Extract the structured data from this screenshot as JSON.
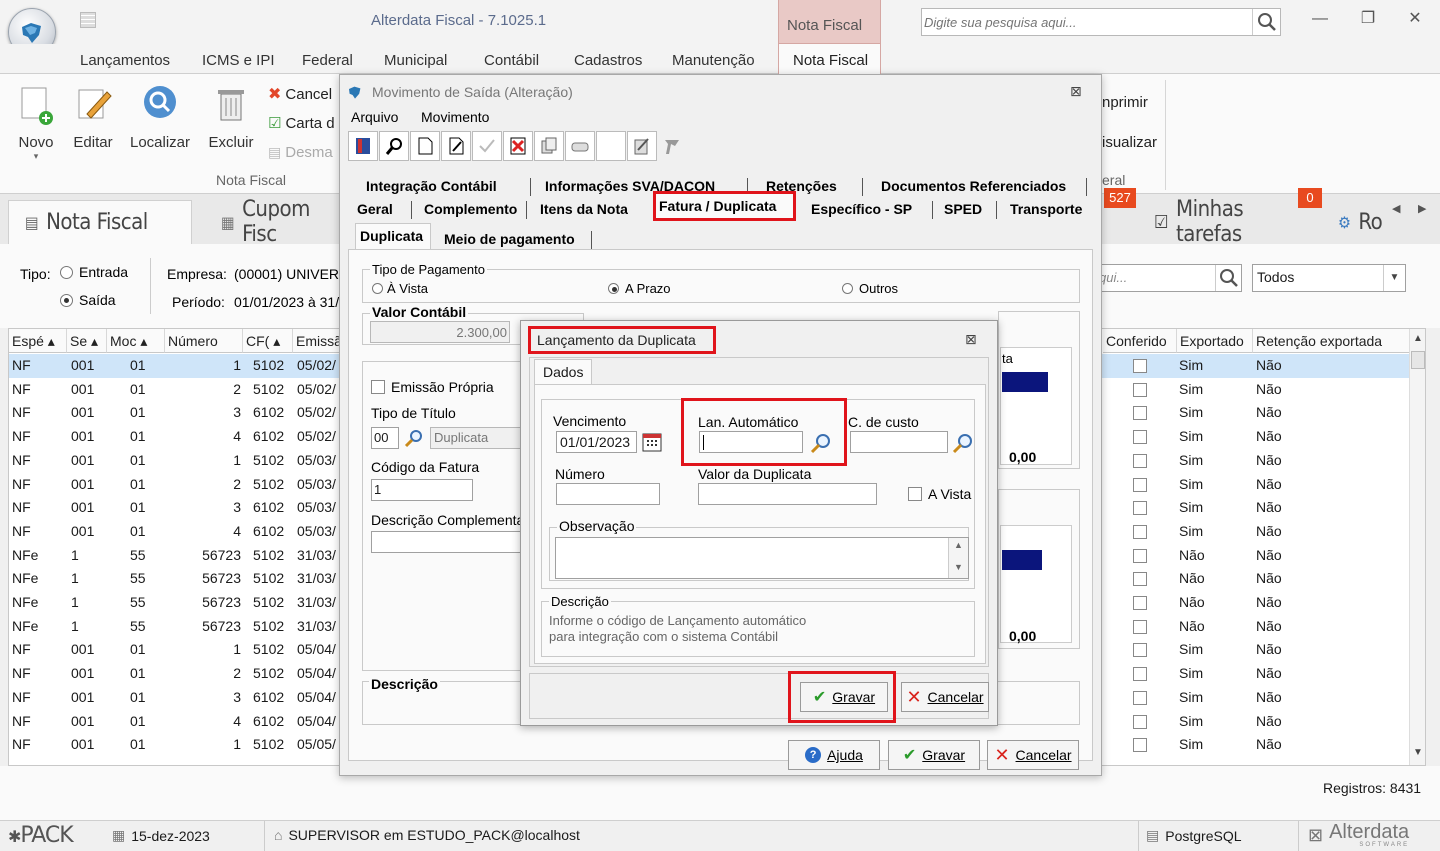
{
  "app": {
    "title": "Alterdata Fiscal - 7.1025.1",
    "contextual_tab": "Nota Fiscal",
    "search_placeholder": "Digite sua pesquisa aqui..."
  },
  "menu": [
    "Lançamentos",
    "ICMS e IPI",
    "Federal",
    "Municipal",
    "Contábil",
    "Cadastros",
    "Manutenção",
    "Nota Fiscal"
  ],
  "ribbon": {
    "novo": "Novo",
    "editar": "Editar",
    "localizar": "Localizar",
    "excluir": "Excluir",
    "cancelar": "Cancel",
    "carta": "Carta d",
    "desmarcar": "Desma",
    "group_label": "Nota Fiscal",
    "imprimir": "nprimir",
    "visualizar": "isualizar",
    "geral": "eral"
  },
  "doc_tabs": {
    "nota_fiscal": "Nota Fiscal",
    "cupom": "Cupom Fisc",
    "minhas_tarefas": "Minhas tarefas",
    "ro": "Ro",
    "badge_527": "527",
    "badge_0": "0"
  },
  "filters": {
    "tipo_label": "Tipo:",
    "entrada": "Entrada",
    "saida": "Saída",
    "empresa_label": "Empresa:",
    "empresa_value": "(00001) UNIVERS",
    "periodo_label": "Período:",
    "periodo_value": "01/01/2023 à 31/",
    "search_placeholder": "qui...",
    "todos": "Todos"
  },
  "grid": {
    "headers": [
      "Espé",
      "Se",
      "Moc",
      "Número",
      "CF(",
      "Emissã",
      "Conferido",
      "Exportado",
      "Retenção exportada"
    ],
    "rows": [
      [
        "NF",
        "001",
        "01",
        "1",
        "5102",
        "05/02/",
        "Sim",
        "Não"
      ],
      [
        "NF",
        "001",
        "01",
        "2",
        "5102",
        "05/02/",
        "Sim",
        "Não"
      ],
      [
        "NF",
        "001",
        "01",
        "3",
        "6102",
        "05/02/",
        "Sim",
        "Não"
      ],
      [
        "NF",
        "001",
        "01",
        "4",
        "6102",
        "05/02/",
        "Sim",
        "Não"
      ],
      [
        "NF",
        "001",
        "01",
        "1",
        "5102",
        "05/03/",
        "Sim",
        "Não"
      ],
      [
        "NF",
        "001",
        "01",
        "2",
        "5102",
        "05/03/",
        "Sim",
        "Não"
      ],
      [
        "NF",
        "001",
        "01",
        "3",
        "6102",
        "05/03/",
        "Sim",
        "Não"
      ],
      [
        "NF",
        "001",
        "01",
        "4",
        "6102",
        "05/03/",
        "Sim",
        "Não"
      ],
      [
        "NFe",
        "1",
        "55",
        "56723",
        "5102",
        "31/03/",
        "Não",
        "Não"
      ],
      [
        "NFe",
        "1",
        "55",
        "56723",
        "5102",
        "31/03/",
        "Não",
        "Não"
      ],
      [
        "NFe",
        "1",
        "55",
        "56723",
        "5102",
        "31/03/",
        "Não",
        "Não"
      ],
      [
        "NFe",
        "1",
        "55",
        "56723",
        "5102",
        "31/03/",
        "Não",
        "Não"
      ],
      [
        "NF",
        "001",
        "01",
        "1",
        "5102",
        "05/04/",
        "Sim",
        "Não"
      ],
      [
        "NF",
        "001",
        "01",
        "2",
        "5102",
        "05/04/",
        "Sim",
        "Não"
      ],
      [
        "NF",
        "001",
        "01",
        "3",
        "6102",
        "05/04/",
        "Sim",
        "Não"
      ],
      [
        "NF",
        "001",
        "01",
        "4",
        "6102",
        "05/04/",
        "Sim",
        "Não"
      ],
      [
        "NF",
        "001",
        "01",
        "1",
        "5102",
        "05/05/",
        "Sim",
        "Não"
      ]
    ],
    "registros": "Registros: 8431"
  },
  "statusbar": {
    "pack": "PACK",
    "date": "15-dez-2023",
    "user": "SUPERVISOR em ESTUDO_PACK@localhost",
    "db": "PostgreSQL",
    "brand": "Alterdata",
    "brand_sub": "SOFTWARE"
  },
  "dialog": {
    "title": "Movimento de Saída (Alteração)",
    "menu": [
      "Arquivo",
      "Movimento"
    ],
    "tabs_row1": [
      "Integração Contábil",
      "Informações SVA/DACON",
      "Retenções",
      "Documentos Referenciados"
    ],
    "tabs_row2": [
      "Geral",
      "Complemento",
      "Itens da Nota",
      "Fatura / Duplicata",
      "Específico - SP",
      "SPED",
      "Transporte"
    ],
    "subtabs": [
      "Duplicata",
      "Meio de pagamento"
    ],
    "tipo_pagamento": "Tipo de Pagamento",
    "a_vista": "À Vista",
    "a_prazo": "A Prazo",
    "outros": "Outros",
    "valor_contabil": "Valor Contábil",
    "valor_value": "2.300,00",
    "emissao_propria": "Emissão Própria",
    "tipo_titulo": "Tipo de Título",
    "tipo_titulo_code": "00",
    "tipo_titulo_desc": "Duplicata",
    "codigo_fatura": "Código da Fatura",
    "codigo_value": "1",
    "descricao_complementar": "Descrição Complementar",
    "descricao": "Descrição",
    "right_ta": "ta",
    "total1": "0,00",
    "total2": "0,00",
    "ajuda": "Ajuda",
    "gravar": "Gravar",
    "cancelar": "Cancelar"
  },
  "inner": {
    "title": "Lançamento da Duplicata",
    "tab": "Dados",
    "vencimento": "Vencimento",
    "vencimento_value": "01/01/2023",
    "lan_automatico": "Lan. Automático",
    "c_custo": "C. de custo",
    "numero": "Número",
    "valor_duplicata": "Valor da Duplicata",
    "a_vista": "A Vista",
    "observacao": "Observação",
    "descricao_label": "Descrição",
    "descricao_text1": "Informe o código de Lançamento automático",
    "descricao_text2": "para integração com o sistema Contábil",
    "gravar": "Gravar",
    "cancelar": "Cancelar"
  },
  "colors": {
    "highlight_row": "#cfe5f9",
    "red_box": "#e0141b",
    "navy_bar": "#0b157c",
    "badge": "#e84a1f"
  }
}
